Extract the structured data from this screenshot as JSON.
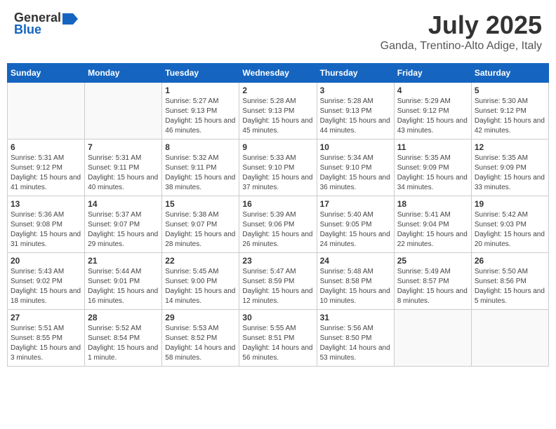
{
  "header": {
    "logo_general": "General",
    "logo_blue": "Blue",
    "month": "July 2025",
    "location": "Ganda, Trentino-Alto Adige, Italy"
  },
  "days_of_week": [
    "Sunday",
    "Monday",
    "Tuesday",
    "Wednesday",
    "Thursday",
    "Friday",
    "Saturday"
  ],
  "weeks": [
    [
      {
        "day": "",
        "sunrise": "",
        "sunset": "",
        "daylight": ""
      },
      {
        "day": "",
        "sunrise": "",
        "sunset": "",
        "daylight": ""
      },
      {
        "day": "1",
        "sunrise": "Sunrise: 5:27 AM",
        "sunset": "Sunset: 9:13 PM",
        "daylight": "Daylight: 15 hours and 46 minutes."
      },
      {
        "day": "2",
        "sunrise": "Sunrise: 5:28 AM",
        "sunset": "Sunset: 9:13 PM",
        "daylight": "Daylight: 15 hours and 45 minutes."
      },
      {
        "day": "3",
        "sunrise": "Sunrise: 5:28 AM",
        "sunset": "Sunset: 9:13 PM",
        "daylight": "Daylight: 15 hours and 44 minutes."
      },
      {
        "day": "4",
        "sunrise": "Sunrise: 5:29 AM",
        "sunset": "Sunset: 9:12 PM",
        "daylight": "Daylight: 15 hours and 43 minutes."
      },
      {
        "day": "5",
        "sunrise": "Sunrise: 5:30 AM",
        "sunset": "Sunset: 9:12 PM",
        "daylight": "Daylight: 15 hours and 42 minutes."
      }
    ],
    [
      {
        "day": "6",
        "sunrise": "Sunrise: 5:31 AM",
        "sunset": "Sunset: 9:12 PM",
        "daylight": "Daylight: 15 hours and 41 minutes."
      },
      {
        "day": "7",
        "sunrise": "Sunrise: 5:31 AM",
        "sunset": "Sunset: 9:11 PM",
        "daylight": "Daylight: 15 hours and 40 minutes."
      },
      {
        "day": "8",
        "sunrise": "Sunrise: 5:32 AM",
        "sunset": "Sunset: 9:11 PM",
        "daylight": "Daylight: 15 hours and 38 minutes."
      },
      {
        "day": "9",
        "sunrise": "Sunrise: 5:33 AM",
        "sunset": "Sunset: 9:10 PM",
        "daylight": "Daylight: 15 hours and 37 minutes."
      },
      {
        "day": "10",
        "sunrise": "Sunrise: 5:34 AM",
        "sunset": "Sunset: 9:10 PM",
        "daylight": "Daylight: 15 hours and 36 minutes."
      },
      {
        "day": "11",
        "sunrise": "Sunrise: 5:35 AM",
        "sunset": "Sunset: 9:09 PM",
        "daylight": "Daylight: 15 hours and 34 minutes."
      },
      {
        "day": "12",
        "sunrise": "Sunrise: 5:35 AM",
        "sunset": "Sunset: 9:09 PM",
        "daylight": "Daylight: 15 hours and 33 minutes."
      }
    ],
    [
      {
        "day": "13",
        "sunrise": "Sunrise: 5:36 AM",
        "sunset": "Sunset: 9:08 PM",
        "daylight": "Daylight: 15 hours and 31 minutes."
      },
      {
        "day": "14",
        "sunrise": "Sunrise: 5:37 AM",
        "sunset": "Sunset: 9:07 PM",
        "daylight": "Daylight: 15 hours and 29 minutes."
      },
      {
        "day": "15",
        "sunrise": "Sunrise: 5:38 AM",
        "sunset": "Sunset: 9:07 PM",
        "daylight": "Daylight: 15 hours and 28 minutes."
      },
      {
        "day": "16",
        "sunrise": "Sunrise: 5:39 AM",
        "sunset": "Sunset: 9:06 PM",
        "daylight": "Daylight: 15 hours and 26 minutes."
      },
      {
        "day": "17",
        "sunrise": "Sunrise: 5:40 AM",
        "sunset": "Sunset: 9:05 PM",
        "daylight": "Daylight: 15 hours and 24 minutes."
      },
      {
        "day": "18",
        "sunrise": "Sunrise: 5:41 AM",
        "sunset": "Sunset: 9:04 PM",
        "daylight": "Daylight: 15 hours and 22 minutes."
      },
      {
        "day": "19",
        "sunrise": "Sunrise: 5:42 AM",
        "sunset": "Sunset: 9:03 PM",
        "daylight": "Daylight: 15 hours and 20 minutes."
      }
    ],
    [
      {
        "day": "20",
        "sunrise": "Sunrise: 5:43 AM",
        "sunset": "Sunset: 9:02 PM",
        "daylight": "Daylight: 15 hours and 18 minutes."
      },
      {
        "day": "21",
        "sunrise": "Sunrise: 5:44 AM",
        "sunset": "Sunset: 9:01 PM",
        "daylight": "Daylight: 15 hours and 16 minutes."
      },
      {
        "day": "22",
        "sunrise": "Sunrise: 5:45 AM",
        "sunset": "Sunset: 9:00 PM",
        "daylight": "Daylight: 15 hours and 14 minutes."
      },
      {
        "day": "23",
        "sunrise": "Sunrise: 5:47 AM",
        "sunset": "Sunset: 8:59 PM",
        "daylight": "Daylight: 15 hours and 12 minutes."
      },
      {
        "day": "24",
        "sunrise": "Sunrise: 5:48 AM",
        "sunset": "Sunset: 8:58 PM",
        "daylight": "Daylight: 15 hours and 10 minutes."
      },
      {
        "day": "25",
        "sunrise": "Sunrise: 5:49 AM",
        "sunset": "Sunset: 8:57 PM",
        "daylight": "Daylight: 15 hours and 8 minutes."
      },
      {
        "day": "26",
        "sunrise": "Sunrise: 5:50 AM",
        "sunset": "Sunset: 8:56 PM",
        "daylight": "Daylight: 15 hours and 5 minutes."
      }
    ],
    [
      {
        "day": "27",
        "sunrise": "Sunrise: 5:51 AM",
        "sunset": "Sunset: 8:55 PM",
        "daylight": "Daylight: 15 hours and 3 minutes."
      },
      {
        "day": "28",
        "sunrise": "Sunrise: 5:52 AM",
        "sunset": "Sunset: 8:54 PM",
        "daylight": "Daylight: 15 hours and 1 minute."
      },
      {
        "day": "29",
        "sunrise": "Sunrise: 5:53 AM",
        "sunset": "Sunset: 8:52 PM",
        "daylight": "Daylight: 14 hours and 58 minutes."
      },
      {
        "day": "30",
        "sunrise": "Sunrise: 5:55 AM",
        "sunset": "Sunset: 8:51 PM",
        "daylight": "Daylight: 14 hours and 56 minutes."
      },
      {
        "day": "31",
        "sunrise": "Sunrise: 5:56 AM",
        "sunset": "Sunset: 8:50 PM",
        "daylight": "Daylight: 14 hours and 53 minutes."
      },
      {
        "day": "",
        "sunrise": "",
        "sunset": "",
        "daylight": ""
      },
      {
        "day": "",
        "sunrise": "",
        "sunset": "",
        "daylight": ""
      }
    ]
  ]
}
